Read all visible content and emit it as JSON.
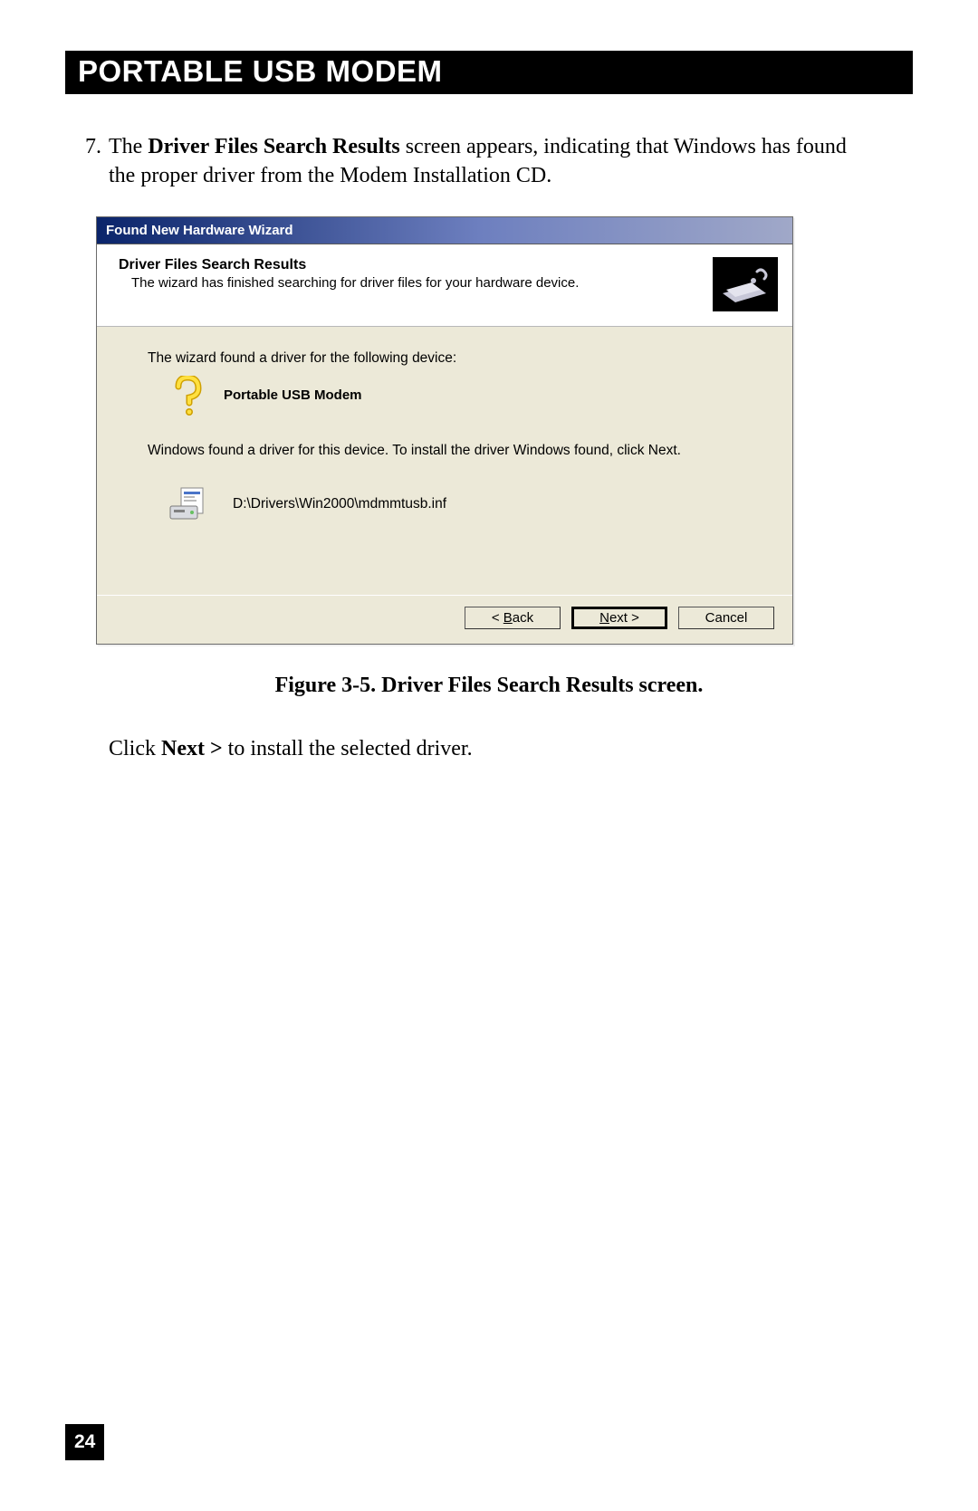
{
  "header": {
    "title": "PORTABLE USB MODEM"
  },
  "step": {
    "number": "7.",
    "pre": "The ",
    "bold": "Driver Files Search Results",
    "post": " screen appears, indicating that Windows has found the proper driver from the Modem Installation CD."
  },
  "wizard": {
    "titlebar": "Found New Hardware Wizard",
    "header_title": "Driver Files Search Results",
    "header_sub": "The wizard has finished searching for driver files for your hardware device.",
    "found_line": "The wizard found a driver for the following device:",
    "device_name": "Portable USB Modem",
    "instr_line": "Windows found a driver for this device. To install the driver Windows found, click Next.",
    "driver_path": "D:\\Drivers\\Win2000\\mdmmtusb.inf",
    "buttons": {
      "back_prefix": "< ",
      "back_u": "B",
      "back_rest": "ack",
      "next_u": "N",
      "next_rest": "ext >",
      "cancel": "Cancel"
    }
  },
  "figure_caption": "Figure 3-5. Driver Files Search Results screen.",
  "after": {
    "pre": "Click ",
    "bold": "Next >",
    "post": " to install the selected driver."
  },
  "page_number": "24"
}
